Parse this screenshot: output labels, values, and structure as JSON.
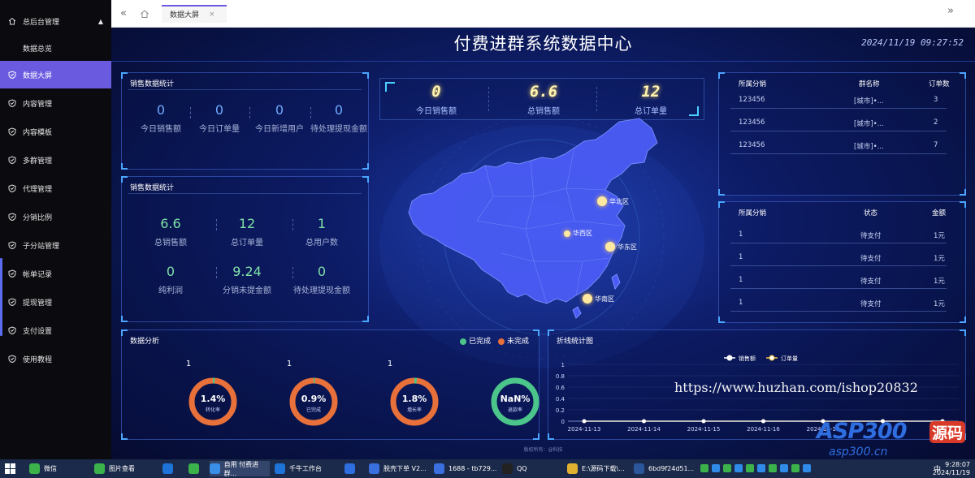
{
  "sidebar": {
    "header": "总后台管理",
    "items": [
      {
        "label": "数据总览",
        "icon": "none"
      },
      {
        "label": "数据大屏",
        "icon": "shield-check-icon",
        "active": true
      },
      {
        "label": "内容管理",
        "icon": "shield-check-icon"
      },
      {
        "label": "内容模板",
        "icon": "shield-check-icon"
      },
      {
        "label": "多群管理",
        "icon": "shield-check-icon"
      },
      {
        "label": "代理管理",
        "icon": "shield-check-icon"
      },
      {
        "label": "分销比例",
        "icon": "shield-check-icon"
      },
      {
        "label": "子分站管理",
        "icon": "shield-check-icon"
      },
      {
        "label": "帐单记录",
        "icon": "shield-check-icon"
      },
      {
        "label": "提现管理",
        "icon": "shield-check-icon"
      },
      {
        "label": "支付设置",
        "icon": "shield-check-icon"
      },
      {
        "label": "使用教程",
        "icon": "shield-check-icon"
      }
    ]
  },
  "tabbar": {
    "tab_label": "数据大屏",
    "tab_close": "×"
  },
  "dashboard": {
    "title": "付费进群系统数据中心",
    "datetime": "2024/11/19 09:27:52",
    "sales_stats_1": {
      "title": "销售数据统计",
      "items": [
        {
          "value": "0",
          "label": "今日销售额"
        },
        {
          "value": "0",
          "label": "今日订单量"
        },
        {
          "value": "0",
          "label": "今日新增用户"
        },
        {
          "value": "0",
          "label": "待处理提现金额"
        }
      ]
    },
    "sales_stats_2": {
      "title": "销售数据统计",
      "items": [
        {
          "value": "6.6",
          "label": "总销售额"
        },
        {
          "value": "12",
          "label": "总订单量"
        },
        {
          "value": "1",
          "label": "总用户数"
        },
        {
          "value": "0",
          "label": "纯利润"
        },
        {
          "value": "9.24",
          "label": "分销未提金额"
        },
        {
          "value": "0",
          "label": "待处理提现金额"
        }
      ]
    },
    "kpis": [
      {
        "value": "0",
        "label": "今日销售额"
      },
      {
        "value": "6.6",
        "label": "总销售额"
      },
      {
        "value": "12",
        "label": "总订单量"
      }
    ],
    "map_regions": [
      "华北区",
      "华西区",
      "华东区",
      "华南区"
    ],
    "groups_table": {
      "headers": [
        "所属分销",
        "群名称",
        "订单数"
      ],
      "rows": [
        [
          "123456",
          "[城市]•...",
          "3"
        ],
        [
          "123456",
          "[城市]•...",
          "2"
        ],
        [
          "123456",
          "[城市]•...",
          "7"
        ]
      ]
    },
    "orders_table": {
      "headers": [
        "所属分销",
        "状态",
        "金额"
      ],
      "rows": [
        [
          "1",
          "待支付",
          "1元"
        ],
        [
          "1",
          "待支付",
          "1元"
        ],
        [
          "1",
          "待支付",
          "1元"
        ],
        [
          "1",
          "待支付",
          "1元"
        ]
      ]
    },
    "analysis": {
      "title": "数据分析",
      "legend_done": "已完成",
      "legend_undone": "未完成",
      "color_done": "#4cc58a",
      "color_undone": "#e8703a",
      "donuts": [
        {
          "top": "1",
          "pct": "1.4%",
          "sub": "转化率",
          "fraction": 0.014,
          "style": "orange"
        },
        {
          "top": "1",
          "pct": "0.9%",
          "sub": "已完成",
          "fraction": 0.009,
          "style": "orange"
        },
        {
          "top": "1",
          "pct": "1.8%",
          "sub": "増长率",
          "fraction": 0.018,
          "style": "orange"
        },
        {
          "top": "",
          "pct": "NaN%",
          "sub": "退款率",
          "fraction": 0,
          "style": "green"
        }
      ]
    },
    "footer": "版权所有：@科技"
  },
  "chart_data": {
    "type": "line",
    "title": "折线统计图",
    "categories": [
      "2024-11-13",
      "2024-11-14",
      "2024-11-15",
      "2024-11-16",
      "2024-11-17",
      "2024-11-18",
      "2024-11-19"
    ],
    "visible_x_labels": [
      "2024-11-13",
      "2024-11-14",
      "2024-11-15",
      "2024-11-16",
      "2024-11-17"
    ],
    "series": [
      {
        "name": "销售额",
        "values": [
          0,
          0,
          0,
          0,
          0,
          0,
          0
        ],
        "color": "#ffffff"
      },
      {
        "name": "订单量",
        "values": [
          0,
          0,
          0,
          0,
          0,
          0,
          0
        ],
        "color": "#f0c040"
      }
    ],
    "y_ticks": [
      "0",
      "0.2",
      "0.4",
      "0.6",
      "0.8",
      "1"
    ],
    "ylim": [
      0,
      1
    ],
    "legend_position": "top-right"
  },
  "watermark": {
    "url": "https://www.huzhan.com/ishop20832",
    "brand": "ASP300",
    "brand_suffix": "源码",
    "site": "asp300.cn"
  },
  "taskbar": {
    "items": [
      "微信",
      "图片查看",
      "",
      "",
      "自用 付费进群...",
      "千牛工作台",
      "",
      "脱壳下单 V2...",
      "1688 - tb729...",
      "QQ",
      "E:\\源码下载\\...",
      "6bd9f24d51..."
    ],
    "time": "9:28:07",
    "date": "2024/11/19",
    "ime": "中"
  }
}
